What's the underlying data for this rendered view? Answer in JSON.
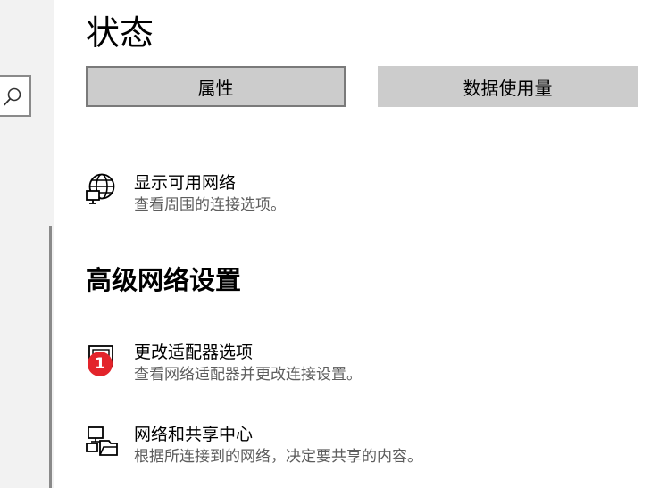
{
  "page": {
    "title": "状态"
  },
  "tabs": {
    "properties_label": "属性",
    "data_usage_label": "数据使用量"
  },
  "show_networks": {
    "title": "显示可用网络",
    "description": "查看周围的连接选项。",
    "icon": "globe-monitor-icon"
  },
  "advanced": {
    "section_title": "高级网络设置",
    "items": [
      {
        "title": "更改适配器选项",
        "description": "查看网络适配器并更改连接设置。",
        "icon": "adapter-monitor-icon",
        "badge": "1"
      },
      {
        "title": "网络和共享中心",
        "description": "根据所连接到的网络，决定要共享的内容。",
        "icon": "sharing-center-icon"
      }
    ]
  },
  "sidebar": {
    "search_icon": "search-icon"
  },
  "colors": {
    "button_bg": "#cccccc",
    "description_text": "#5d5d5d",
    "badge": "#e3242b"
  }
}
